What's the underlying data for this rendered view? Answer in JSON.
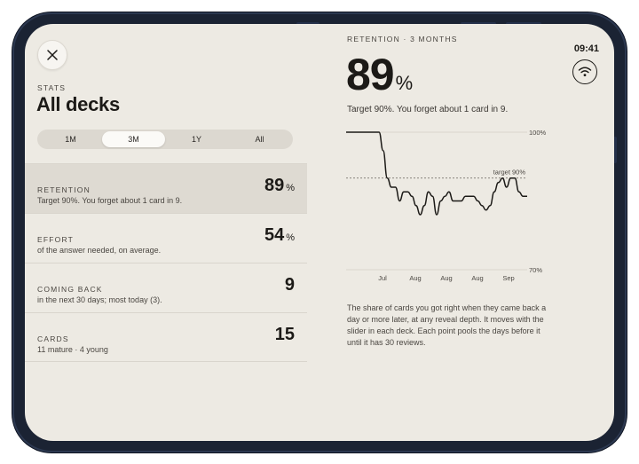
{
  "status": {
    "time": "09:41"
  },
  "stats": {
    "eyebrow": "STATS",
    "title": "All decks",
    "ranges": [
      "1M",
      "3M",
      "1Y",
      "All"
    ],
    "selected_range": "3M",
    "rows": [
      {
        "label": "RETENTION",
        "value": "89",
        "unit": "%",
        "sub": "Target 90%. You forget about 1 card in 9.",
        "selected": true
      },
      {
        "label": "EFFORT",
        "value": "54",
        "unit": "%",
        "sub": "of the answer needed, on average.",
        "selected": false
      },
      {
        "label": "COMING BACK",
        "value": "9",
        "unit": "",
        "sub": "in the next 30 days; most today (3).",
        "selected": false
      },
      {
        "label": "CARDS",
        "value": "15",
        "unit": "",
        "sub": "11 mature · 4 young",
        "selected": false
      }
    ]
  },
  "detail": {
    "eyebrow": "RETENTION · 3 MONTHS",
    "value": "89",
    "unit": "%",
    "description": "Target 90%. You forget about 1 card in 9.",
    "note": "The share of cards you got right when they came back a day or more later, at any reveal depth. It moves with the slider in each deck. Each point pools the days before it until it has 30 reviews."
  },
  "chart_data": {
    "type": "line",
    "x_tick_labels": [
      "Jul",
      "Aug",
      "Aug",
      "Aug",
      "Sep"
    ],
    "ylim": [
      70,
      100
    ],
    "y_tick_labels": [
      "100%",
      "70%"
    ],
    "target": {
      "value": 90,
      "label": "target 90%"
    },
    "series": [
      {
        "values": [
          100,
          100,
          100,
          100,
          100,
          100,
          100,
          100,
          100,
          96,
          90,
          88,
          88,
          85,
          87,
          87,
          86,
          84,
          82,
          84,
          87,
          86,
          82,
          85,
          86,
          87,
          85,
          85,
          85,
          86,
          86,
          86,
          85,
          84,
          83,
          84,
          87,
          89,
          90,
          88,
          90,
          90,
          87,
          86,
          86
        ]
      }
    ]
  }
}
